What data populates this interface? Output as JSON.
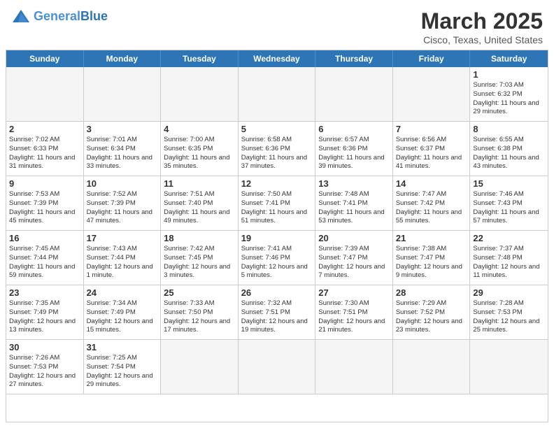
{
  "header": {
    "logo_general": "General",
    "logo_blue": "Blue",
    "month_title": "March 2025",
    "location": "Cisco, Texas, United States"
  },
  "days_of_week": [
    "Sunday",
    "Monday",
    "Tuesday",
    "Wednesday",
    "Thursday",
    "Friday",
    "Saturday"
  ],
  "cells": [
    {
      "day": "",
      "info": "",
      "empty": true
    },
    {
      "day": "",
      "info": "",
      "empty": true
    },
    {
      "day": "",
      "info": "",
      "empty": true
    },
    {
      "day": "",
      "info": "",
      "empty": true
    },
    {
      "day": "",
      "info": "",
      "empty": true
    },
    {
      "day": "",
      "info": "",
      "empty": true
    },
    {
      "day": "1",
      "info": "Sunrise: 7:03 AM\nSunset: 6:32 PM\nDaylight: 11 hours and 29 minutes.",
      "empty": false
    },
    {
      "day": "2",
      "info": "Sunrise: 7:02 AM\nSunset: 6:33 PM\nDaylight: 11 hours and 31 minutes.",
      "empty": false
    },
    {
      "day": "3",
      "info": "Sunrise: 7:01 AM\nSunset: 6:34 PM\nDaylight: 11 hours and 33 minutes.",
      "empty": false
    },
    {
      "day": "4",
      "info": "Sunrise: 7:00 AM\nSunset: 6:35 PM\nDaylight: 11 hours and 35 minutes.",
      "empty": false
    },
    {
      "day": "5",
      "info": "Sunrise: 6:58 AM\nSunset: 6:36 PM\nDaylight: 11 hours and 37 minutes.",
      "empty": false
    },
    {
      "day": "6",
      "info": "Sunrise: 6:57 AM\nSunset: 6:36 PM\nDaylight: 11 hours and 39 minutes.",
      "empty": false
    },
    {
      "day": "7",
      "info": "Sunrise: 6:56 AM\nSunset: 6:37 PM\nDaylight: 11 hours and 41 minutes.",
      "empty": false
    },
    {
      "day": "8",
      "info": "Sunrise: 6:55 AM\nSunset: 6:38 PM\nDaylight: 11 hours and 43 minutes.",
      "empty": false
    },
    {
      "day": "9",
      "info": "Sunrise: 7:53 AM\nSunset: 7:39 PM\nDaylight: 11 hours and 45 minutes.",
      "empty": false
    },
    {
      "day": "10",
      "info": "Sunrise: 7:52 AM\nSunset: 7:39 PM\nDaylight: 11 hours and 47 minutes.",
      "empty": false
    },
    {
      "day": "11",
      "info": "Sunrise: 7:51 AM\nSunset: 7:40 PM\nDaylight: 11 hours and 49 minutes.",
      "empty": false
    },
    {
      "day": "12",
      "info": "Sunrise: 7:50 AM\nSunset: 7:41 PM\nDaylight: 11 hours and 51 minutes.",
      "empty": false
    },
    {
      "day": "13",
      "info": "Sunrise: 7:48 AM\nSunset: 7:41 PM\nDaylight: 11 hours and 53 minutes.",
      "empty": false
    },
    {
      "day": "14",
      "info": "Sunrise: 7:47 AM\nSunset: 7:42 PM\nDaylight: 11 hours and 55 minutes.",
      "empty": false
    },
    {
      "day": "15",
      "info": "Sunrise: 7:46 AM\nSunset: 7:43 PM\nDaylight: 11 hours and 57 minutes.",
      "empty": false
    },
    {
      "day": "16",
      "info": "Sunrise: 7:45 AM\nSunset: 7:44 PM\nDaylight: 11 hours and 59 minutes.",
      "empty": false
    },
    {
      "day": "17",
      "info": "Sunrise: 7:43 AM\nSunset: 7:44 PM\nDaylight: 12 hours and 1 minute.",
      "empty": false
    },
    {
      "day": "18",
      "info": "Sunrise: 7:42 AM\nSunset: 7:45 PM\nDaylight: 12 hours and 3 minutes.",
      "empty": false
    },
    {
      "day": "19",
      "info": "Sunrise: 7:41 AM\nSunset: 7:46 PM\nDaylight: 12 hours and 5 minutes.",
      "empty": false
    },
    {
      "day": "20",
      "info": "Sunrise: 7:39 AM\nSunset: 7:47 PM\nDaylight: 12 hours and 7 minutes.",
      "empty": false
    },
    {
      "day": "21",
      "info": "Sunrise: 7:38 AM\nSunset: 7:47 PM\nDaylight: 12 hours and 9 minutes.",
      "empty": false
    },
    {
      "day": "22",
      "info": "Sunrise: 7:37 AM\nSunset: 7:48 PM\nDaylight: 12 hours and 11 minutes.",
      "empty": false
    },
    {
      "day": "23",
      "info": "Sunrise: 7:35 AM\nSunset: 7:49 PM\nDaylight: 12 hours and 13 minutes.",
      "empty": false
    },
    {
      "day": "24",
      "info": "Sunrise: 7:34 AM\nSunset: 7:49 PM\nDaylight: 12 hours and 15 minutes.",
      "empty": false
    },
    {
      "day": "25",
      "info": "Sunrise: 7:33 AM\nSunset: 7:50 PM\nDaylight: 12 hours and 17 minutes.",
      "empty": false
    },
    {
      "day": "26",
      "info": "Sunrise: 7:32 AM\nSunset: 7:51 PM\nDaylight: 12 hours and 19 minutes.",
      "empty": false
    },
    {
      "day": "27",
      "info": "Sunrise: 7:30 AM\nSunset: 7:51 PM\nDaylight: 12 hours and 21 minutes.",
      "empty": false
    },
    {
      "day": "28",
      "info": "Sunrise: 7:29 AM\nSunset: 7:52 PM\nDaylight: 12 hours and 23 minutes.",
      "empty": false
    },
    {
      "day": "29",
      "info": "Sunrise: 7:28 AM\nSunset: 7:53 PM\nDaylight: 12 hours and 25 minutes.",
      "empty": false
    },
    {
      "day": "30",
      "info": "Sunrise: 7:26 AM\nSunset: 7:53 PM\nDaylight: 12 hours and 27 minutes.",
      "empty": false
    },
    {
      "day": "31",
      "info": "Sunrise: 7:25 AM\nSunset: 7:54 PM\nDaylight: 12 hours and 29 minutes.",
      "empty": false
    },
    {
      "day": "",
      "info": "",
      "empty": true
    },
    {
      "day": "",
      "info": "",
      "empty": true
    },
    {
      "day": "",
      "info": "",
      "empty": true
    },
    {
      "day": "",
      "info": "",
      "empty": true
    },
    {
      "day": "",
      "info": "",
      "empty": true
    }
  ]
}
